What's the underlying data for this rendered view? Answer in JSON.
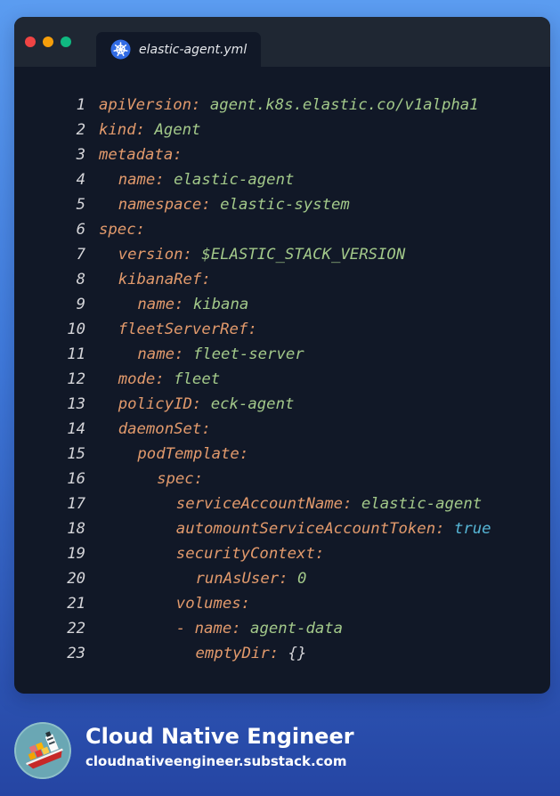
{
  "editor": {
    "tab_title": "elastic-agent.yml",
    "tab_icon": "kubernetes-helm-icon",
    "window_controls": [
      "close",
      "minimize",
      "maximize"
    ],
    "lines": [
      {
        "number": "1",
        "indent": 0,
        "tokens": [
          {
            "text": "apiVersion:",
            "type": "key"
          },
          {
            "text": " ",
            "type": "plain"
          },
          {
            "text": "agent.k8s.elastic.co/v1alpha1",
            "type": "value"
          }
        ]
      },
      {
        "number": "2",
        "indent": 0,
        "tokens": [
          {
            "text": "kind:",
            "type": "key"
          },
          {
            "text": " ",
            "type": "plain"
          },
          {
            "text": "Agent",
            "type": "value"
          }
        ]
      },
      {
        "number": "3",
        "indent": 0,
        "tokens": [
          {
            "text": "metadata:",
            "type": "key"
          }
        ]
      },
      {
        "number": "4",
        "indent": 2,
        "tokens": [
          {
            "text": "name:",
            "type": "key"
          },
          {
            "text": " ",
            "type": "plain"
          },
          {
            "text": "elastic-agent",
            "type": "value"
          }
        ]
      },
      {
        "number": "5",
        "indent": 2,
        "tokens": [
          {
            "text": "namespace:",
            "type": "key"
          },
          {
            "text": " ",
            "type": "plain"
          },
          {
            "text": "elastic-system",
            "type": "value"
          }
        ]
      },
      {
        "number": "6",
        "indent": 0,
        "tokens": [
          {
            "text": "spec:",
            "type": "key"
          }
        ]
      },
      {
        "number": "7",
        "indent": 2,
        "tokens": [
          {
            "text": "version:",
            "type": "key"
          },
          {
            "text": " ",
            "type": "plain"
          },
          {
            "text": "$ELASTIC_STACK_VERSION",
            "type": "value"
          }
        ]
      },
      {
        "number": "8",
        "indent": 2,
        "tokens": [
          {
            "text": "kibanaRef:",
            "type": "key"
          }
        ]
      },
      {
        "number": "9",
        "indent": 4,
        "tokens": [
          {
            "text": "name:",
            "type": "key"
          },
          {
            "text": " ",
            "type": "plain"
          },
          {
            "text": "kibana",
            "type": "value"
          }
        ]
      },
      {
        "number": "10",
        "indent": 2,
        "tokens": [
          {
            "text": "fleetServerRef:",
            "type": "key"
          }
        ]
      },
      {
        "number": "11",
        "indent": 4,
        "tokens": [
          {
            "text": "name:",
            "type": "key"
          },
          {
            "text": " ",
            "type": "plain"
          },
          {
            "text": "fleet-server",
            "type": "value"
          }
        ]
      },
      {
        "number": "12",
        "indent": 2,
        "tokens": [
          {
            "text": "mode:",
            "type": "key"
          },
          {
            "text": " ",
            "type": "plain"
          },
          {
            "text": "fleet",
            "type": "value"
          }
        ]
      },
      {
        "number": "13",
        "indent": 2,
        "tokens": [
          {
            "text": "policyID:",
            "type": "key"
          },
          {
            "text": " ",
            "type": "plain"
          },
          {
            "text": "eck-agent",
            "type": "value"
          }
        ]
      },
      {
        "number": "14",
        "indent": 2,
        "tokens": [
          {
            "text": "daemonSet:",
            "type": "key"
          }
        ]
      },
      {
        "number": "15",
        "indent": 4,
        "tokens": [
          {
            "text": "podTemplate:",
            "type": "key"
          }
        ]
      },
      {
        "number": "16",
        "indent": 6,
        "tokens": [
          {
            "text": "spec:",
            "type": "key"
          }
        ]
      },
      {
        "number": "17",
        "indent": 8,
        "tokens": [
          {
            "text": "serviceAccountName:",
            "type": "key"
          },
          {
            "text": " ",
            "type": "plain"
          },
          {
            "text": "elastic-agent",
            "type": "value"
          }
        ]
      },
      {
        "number": "18",
        "indent": 8,
        "tokens": [
          {
            "text": "automountServiceAccountToken:",
            "type": "key"
          },
          {
            "text": " ",
            "type": "plain"
          },
          {
            "text": "true",
            "type": "bool"
          }
        ]
      },
      {
        "number": "19",
        "indent": 8,
        "tokens": [
          {
            "text": "securityContext:",
            "type": "key"
          }
        ]
      },
      {
        "number": "20",
        "indent": 10,
        "tokens": [
          {
            "text": "runAsUser:",
            "type": "key"
          },
          {
            "text": " ",
            "type": "plain"
          },
          {
            "text": "0",
            "type": "value"
          }
        ]
      },
      {
        "number": "21",
        "indent": 8,
        "tokens": [
          {
            "text": "volumes:",
            "type": "key"
          }
        ]
      },
      {
        "number": "22",
        "indent": 8,
        "tokens": [
          {
            "text": "- name:",
            "type": "key"
          },
          {
            "text": " ",
            "type": "plain"
          },
          {
            "text": "agent-data",
            "type": "value"
          }
        ]
      },
      {
        "number": "23",
        "indent": 10,
        "tokens": [
          {
            "text": "emptyDir:",
            "type": "key"
          },
          {
            "text": " ",
            "type": "plain"
          },
          {
            "text": "{}",
            "type": "punct"
          }
        ]
      }
    ]
  },
  "footer": {
    "brand_name": "Cloud Native Engineer",
    "brand_url": "cloudnativeengineer.substack.com",
    "avatar_icon": "container-ship-icon"
  },
  "colors": {
    "window_background": "#111827",
    "titlebar_background": "#1f2733",
    "key": "#e29a6c",
    "value": "#a3c98a",
    "bool": "#56b6d6",
    "line_number": "#d4d4d8",
    "close_dot": "#ef4444",
    "minimize_dot": "#f59e0b",
    "maximize_dot": "#10b981",
    "page_gradient_top": "#5b9cf0",
    "page_gradient_bottom": "#2545a3"
  }
}
